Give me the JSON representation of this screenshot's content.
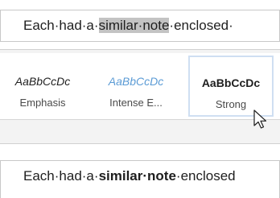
{
  "document": {
    "top_line": {
      "before": "Each·had·a·",
      "selected": "similar·note",
      "after": "·enclosed·"
    },
    "bottom_line": {
      "before": "Each·had·a·",
      "bold": "similar·note",
      "after": "·enclosed"
    }
  },
  "styles_gallery": {
    "items": [
      {
        "preview": "AaBbCcDc",
        "label": "Emphasis"
      },
      {
        "preview": "AaBbCcDc",
        "label": "Intense E..."
      },
      {
        "preview": "AaBbCcDc",
        "label": "Strong"
      }
    ],
    "selected_label": "Strong",
    "accent_color": "#5b9bd5",
    "hover_border_color": "#cfdff2",
    "selection_color": "#c3c3c3"
  },
  "cursor": {
    "icon": "arrow-pointer-icon"
  }
}
